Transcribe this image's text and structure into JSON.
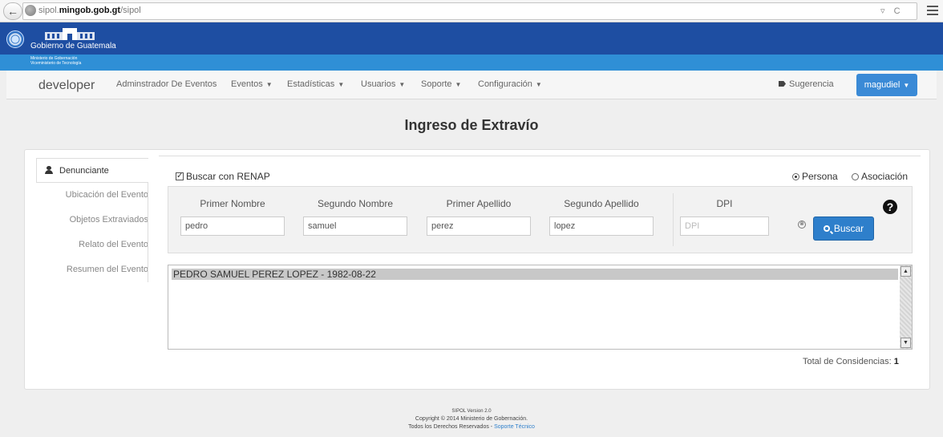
{
  "browser": {
    "url_plain": "sipol.",
    "url_bold": "mingob.gob.gt",
    "url_path": "/sipol",
    "url_right": "▿ C"
  },
  "gov": {
    "name": "Gobierno de Guatemala",
    "ministry": "Ministerio de Gobernación",
    "vice": "Viceministerio de Tecnología"
  },
  "nav": {
    "brand": "developer",
    "items": [
      {
        "label": "Adminstrador De Eventos",
        "caret": false
      },
      {
        "label": "Eventos",
        "caret": true
      },
      {
        "label": "Estadísticas",
        "caret": true
      },
      {
        "label": "Usuarios",
        "caret": true
      },
      {
        "label": "Soporte",
        "caret": true
      },
      {
        "label": "Configuración",
        "caret": true
      }
    ],
    "suggestion": "Sugerencia",
    "user": "magudiel"
  },
  "page": {
    "title": "Ingreso de Extravío"
  },
  "side": {
    "items": [
      "Denunciante",
      "Ubicación del Evento",
      "Objetos Extraviados",
      "Relato del Evento",
      "Resumen del Evento"
    ]
  },
  "form": {
    "renap_label": "Buscar con RENAP",
    "renap_checked": true,
    "radio_persona": "Persona",
    "radio_asociacion": "Asociación",
    "fields": {
      "primer_nombre": {
        "label": "Primer Nombre",
        "value": "pedro"
      },
      "segundo_nombre": {
        "label": "Segundo Nombre",
        "value": "samuel"
      },
      "primer_apellido": {
        "label": "Primer Apellido",
        "value": "perez"
      },
      "segundo_apellido": {
        "label": "Segundo Apellido",
        "value": "lopez"
      },
      "dpi": {
        "label": "DPI",
        "value": "",
        "placeholder": "DPI"
      }
    },
    "search_button": "Buscar",
    "help": "?",
    "clear": "⊗"
  },
  "results": {
    "rows": [
      "PEDRO SAMUEL PEREZ LOPEZ - 1982-08-22"
    ],
    "total_label": "Total de Considencias:",
    "total": "1"
  },
  "footer": {
    "version": "SIPOL Version 2.0",
    "copyright": "Copyright © 2014 Ministerio de Gobernación.",
    "rights": "Todos los Derechos Reservados -",
    "support": "Soporte Técnico"
  },
  "colors": {
    "gov_blue": "#1e4ea2",
    "gov_light": "#2f8fd6",
    "button": "#2e7fcb"
  }
}
